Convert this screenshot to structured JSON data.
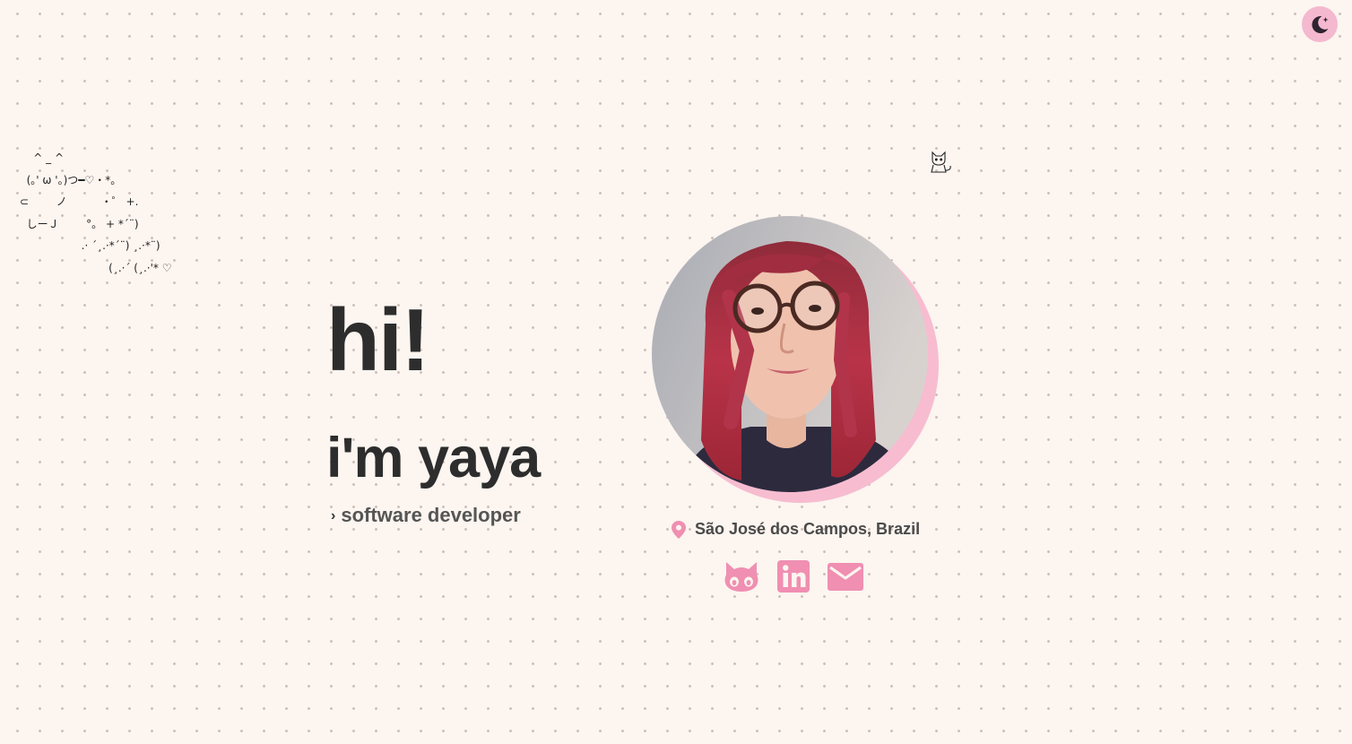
{
  "theme_toggle": {
    "icon": "moon-icon"
  },
  "decoration": {
    "kaomoji": "    ^ _ ^\n  (｡' ω '｡)つ━♡・*。\n⊂        ノ          ・゜ +.\n  しーＪ        °。 + *´¨)\n                  .· ´¸.·*´¨) ¸.·*¨)\n                          (¸.·´ (¸.·'* ♡",
    "cat_icon": "cat-icon"
  },
  "hero": {
    "greeting": "hi!",
    "name": "i'm yaya",
    "role_prefix": "›",
    "role": "software developer"
  },
  "profile": {
    "photo": "profile-photo",
    "location": "São José dos Campos, Brazil",
    "location_icon": "map-pin-icon"
  },
  "socials": [
    {
      "name": "GitHub",
      "icon": "github-icon"
    },
    {
      "name": "LinkedIn",
      "icon": "linkedin-icon"
    },
    {
      "name": "Email",
      "icon": "mail-icon"
    }
  ],
  "colors": {
    "accent": "#f08fb1",
    "background": "#fcf5f0",
    "text": "#2d2d2d"
  }
}
